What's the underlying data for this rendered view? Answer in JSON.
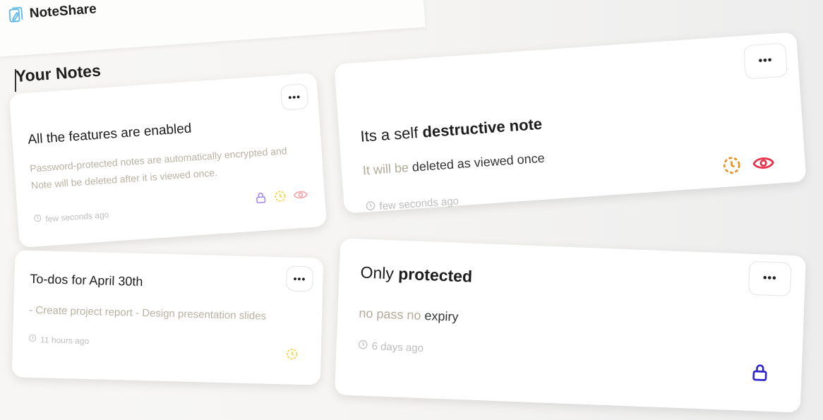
{
  "brand": {
    "name": "NoteShare"
  },
  "page": {
    "title": "Your Notes"
  },
  "menu_label": "•••",
  "colors": {
    "lock_light": "#9b7cf0",
    "timer_light": "#f5d13a",
    "eye_light": "#f2a5aa",
    "timer_strong": "#ef8c15",
    "eye_strong": "#e8314b",
    "lock_strong": "#2b22c9"
  },
  "notes": [
    {
      "title": "All the features are enabled",
      "body": "Password-protected notes are automatically encrypted and Note will be deleted after it is viewed once.",
      "time": "few seconds ago",
      "badges": [
        "lock-icon",
        "timer-icon",
        "eye-icon"
      ]
    },
    {
      "title": "To-dos for April 30th",
      "body": "- Create project report - Design presentation slides",
      "time": "11 hours ago",
      "badges": [
        "timer-icon"
      ]
    },
    {
      "title_prefix": "Its a self ",
      "title_strong": "destructive note",
      "body_prefix": "It will be ",
      "body_strong": "deleted as viewed once",
      "time": "few seconds ago",
      "badges": [
        "timer-icon",
        "eye-icon"
      ]
    },
    {
      "title_prefix": "Only ",
      "title_strong": "protected",
      "body_prefix": "no pass no ",
      "body_strong": "expiry",
      "time": "6 days ago",
      "badges": [
        "lock-icon"
      ]
    }
  ]
}
